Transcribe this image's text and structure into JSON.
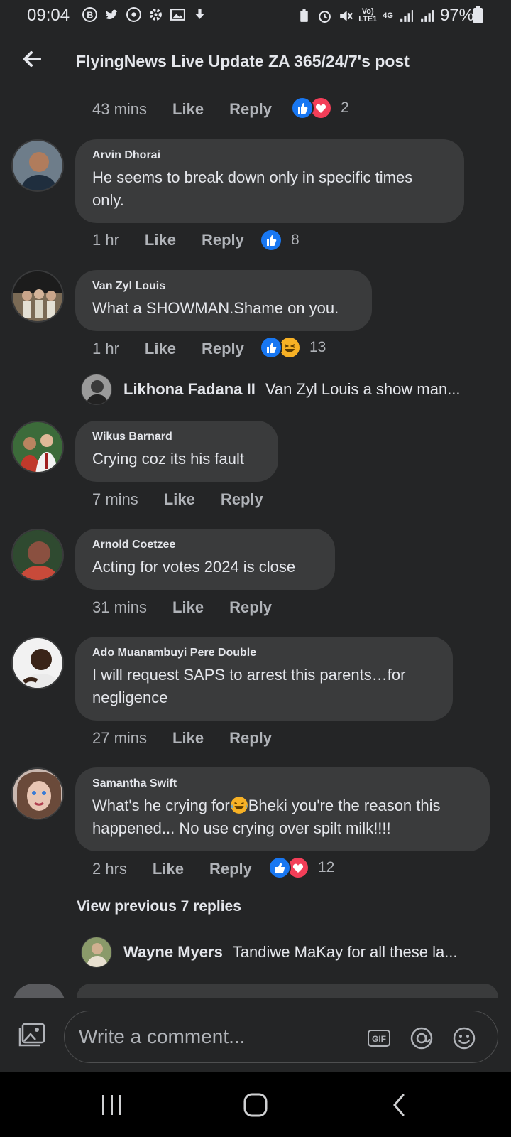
{
  "status_bar": {
    "time": "09:04",
    "volte": "Vo)",
    "lte": "LTE1",
    "network": "4G",
    "battery": "97%"
  },
  "header": {
    "title": "FlyingNews Live Update ZA 365/24/7's post"
  },
  "top_meta": {
    "time": "43 mins",
    "like": "Like",
    "reply": "Reply",
    "count": "2"
  },
  "comments": [
    {
      "name": "Arvin Dhorai",
      "text": "He seems to break down only in specific times only.",
      "time": "1 hr",
      "like": "Like",
      "reply": "Reply",
      "count": "8"
    },
    {
      "name": "Van Zyl Louis",
      "text": "What a SHOWMAN.Shame on you.",
      "time": "1 hr",
      "like": "Like",
      "reply": "Reply",
      "count": "13",
      "reply_preview": {
        "name": "Likhona Fadana II",
        "text": "Van Zyl Louis a show man..."
      }
    },
    {
      "name": "Wikus Barnard",
      "text": "Crying coz its his fault",
      "time": "7 mins",
      "like": "Like",
      "reply": "Reply"
    },
    {
      "name": "Arnold Coetzee",
      "text": "Acting for votes 2024 is close",
      "time": "31 mins",
      "like": "Like",
      "reply": "Reply"
    },
    {
      "name": "Ado Muanambuyi Pere Double",
      "text": "I will request SAPS to arrest this parents…for negligence",
      "time": "27 mins",
      "like": "Like",
      "reply": "Reply"
    },
    {
      "name": "Samantha Swift",
      "text_before": "What's he crying for",
      "text_after": "Bheki you're the reason this happened... No use crying over spilt milk!!!!",
      "time": "2 hrs",
      "like": "Like",
      "reply": "Reply",
      "count": "12"
    }
  ],
  "view_previous": "View previous 7 replies",
  "wayne_preview": {
    "name": "Wayne Myers",
    "text": "Tandiwe MaKay for all these la..."
  },
  "composer": {
    "placeholder": "Write a comment...",
    "gif_label": "GIF"
  },
  "colors": {
    "background": "#242526",
    "bubble": "#3a3b3c",
    "like_blue": "#1877f2",
    "love_red": "#f33e58",
    "haha_yellow": "#f7b125"
  },
  "icons": [
    "back-arrow-icon",
    "photo-icon",
    "gif-icon",
    "at-icon",
    "emoji-icon",
    "like-reaction-icon",
    "love-reaction-icon",
    "haha-reaction-icon"
  ]
}
